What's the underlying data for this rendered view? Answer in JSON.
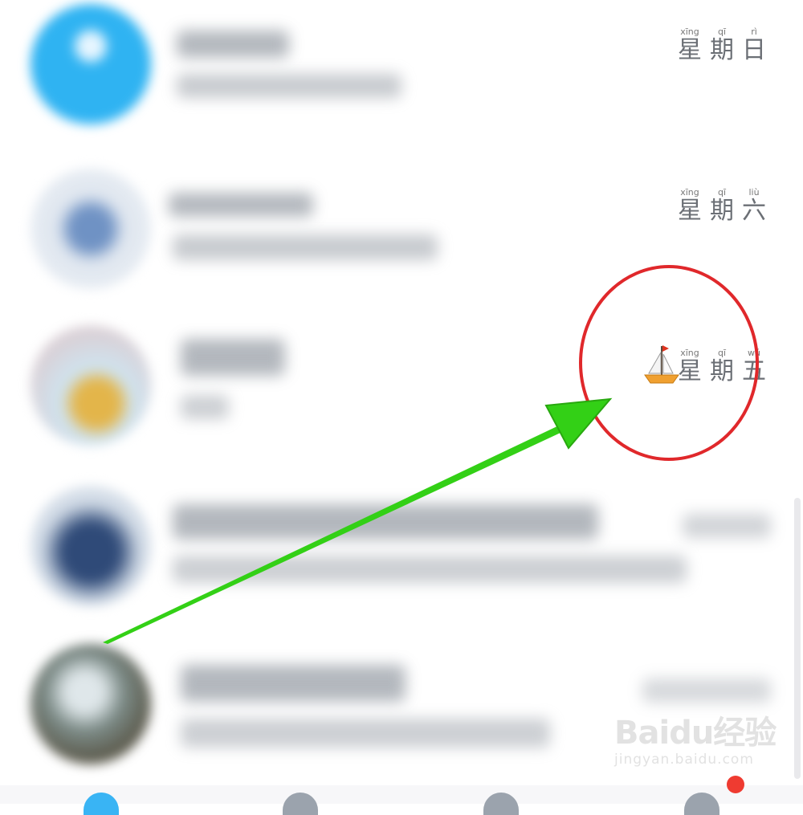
{
  "conversations": [
    {
      "date_hanzi": [
        "星",
        "期",
        "日"
      ],
      "date_pinyin": [
        "xīng",
        "qī",
        "rì"
      ]
    },
    {
      "date_hanzi": [
        "星",
        "期",
        "六"
      ],
      "date_pinyin": [
        "xīng",
        "qī",
        "liù"
      ]
    },
    {
      "date_hanzi": [
        "星",
        "期",
        "五"
      ],
      "date_pinyin": [
        "xīng",
        "qī",
        "wǔ"
      ],
      "status_icon": "sailboat-icon"
    }
  ],
  "annotation": {
    "arrow_color": "#33d016",
    "circle_color": "#e0282b"
  },
  "watermark": {
    "logo": "Baidu经验",
    "url": "jingyan.baidu.com"
  }
}
